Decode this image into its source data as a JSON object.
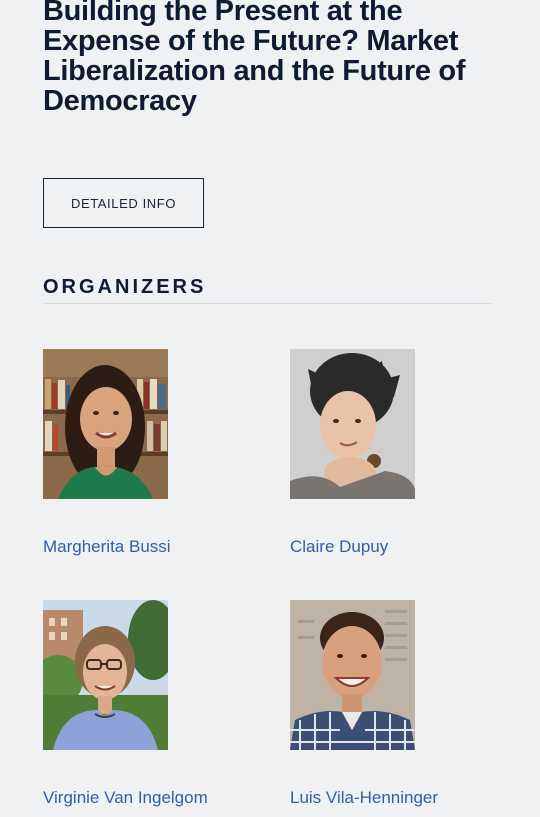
{
  "event": {
    "title": "Building the Present at the Expense of the Future? Market Liberalization and the Future of Democracy"
  },
  "detail_button": {
    "label": "DETAILED INFO"
  },
  "organizers": {
    "heading": "ORGANIZERS",
    "people": [
      {
        "name": "Margherita Bussi"
      },
      {
        "name": "Claire Dupuy"
      },
      {
        "name": "Virginie Van Ingelgom"
      },
      {
        "name": "Luis Vila-Henninger"
      }
    ]
  },
  "colors": {
    "background": "#f0f1f3",
    "title": "#0f1b33",
    "link": "#2f5fa8",
    "rule": "#d8dade"
  }
}
